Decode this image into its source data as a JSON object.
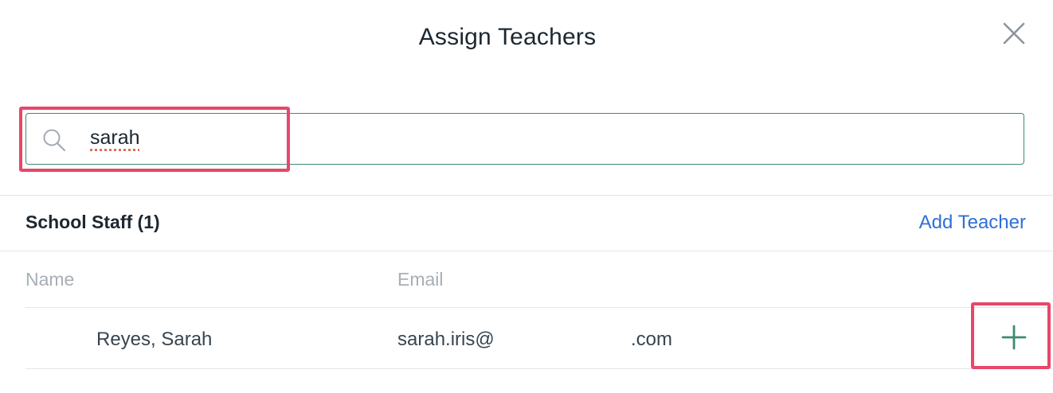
{
  "dialog": {
    "title": "Assign Teachers",
    "close_icon": "close-icon"
  },
  "search": {
    "icon": "search-icon",
    "value": "sarah"
  },
  "section": {
    "title": "School Staff (1)",
    "add_teacher_label": "Add Teacher"
  },
  "table": {
    "columns": [
      "Name",
      "Email"
    ],
    "rows": [
      {
        "name": "Reyes, Sarah",
        "email_user": "sarah.iris@",
        "email_domain": ".com",
        "action_icon": "plus-icon"
      }
    ]
  },
  "colors": {
    "accent_green": "#3d8c6e",
    "link_blue": "#2f6fd6",
    "highlight_pink": "#e8466a"
  }
}
